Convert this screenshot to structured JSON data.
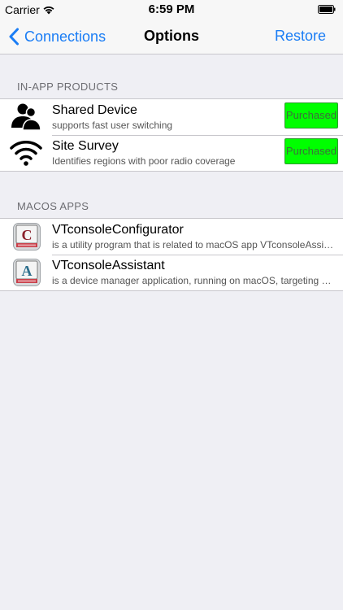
{
  "status_bar": {
    "carrier": "Carrier",
    "time": "6:59 PM"
  },
  "nav": {
    "back_label": "Connections",
    "title": "Options",
    "restore_label": "Restore"
  },
  "colors": {
    "accent": "#1a7df5",
    "purchased_bg": "#00ff00",
    "background": "#efeff4"
  },
  "sections": [
    {
      "header": "IN-APP PRODUCTS",
      "rows": [
        {
          "icon": "users-icon",
          "title": "Shared Device",
          "subtitle": "supports fast user switching",
          "button": "Purchased"
        },
        {
          "icon": "wifi-icon",
          "title": "Site Survey",
          "subtitle": "Identifies regions with poor radio coverage",
          "button": "Purchased"
        }
      ]
    },
    {
      "header": "MACOS APPS",
      "rows": [
        {
          "icon": "vtconsole-configurator-icon",
          "icon_letter": "C",
          "title": "VTconsoleConfigurator",
          "subtitle": "is a utility program that is related to macOS app VTconsoleAssistant"
        },
        {
          "icon": "vtconsole-assistant-icon",
          "icon_letter": "A",
          "title": "VTconsoleAssistant",
          "subtitle": "is a device manager application, running on macOS, targeting VT terminals"
        }
      ]
    }
  ]
}
